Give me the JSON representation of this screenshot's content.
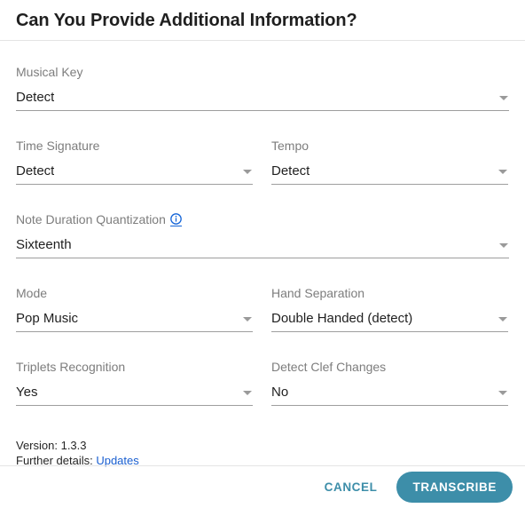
{
  "dialog": {
    "title": "Can You Provide Additional Information?"
  },
  "fields": {
    "musical_key": {
      "label": "Musical Key",
      "value": "Detect"
    },
    "time_signature": {
      "label": "Time Signature",
      "value": "Detect"
    },
    "tempo": {
      "label": "Tempo",
      "value": "Detect"
    },
    "quantization": {
      "label": "Note Duration Quantization",
      "value": "Sixteenth",
      "info_icon": "info-icon"
    },
    "mode": {
      "label": "Mode",
      "value": "Pop Music"
    },
    "hand_separation": {
      "label": "Hand Separation",
      "value": "Double Handed (detect)"
    },
    "triplets": {
      "label": "Triplets Recognition",
      "value": "Yes"
    },
    "clef_changes": {
      "label": "Detect Clef Changes",
      "value": "No"
    }
  },
  "version": {
    "version_line": "Version: 1.3.3",
    "details_prefix": "Further details:",
    "updates_link": "Updates"
  },
  "footer": {
    "cancel_label": "CANCEL",
    "transcribe_label": "TRANSCRIBE"
  },
  "colors": {
    "accent": "#3d8ea9",
    "link": "#1a5fd0",
    "info": "#1565d8",
    "label": "#7d7d7d",
    "divider": "#e4e4e4",
    "underline": "#9e9e9e"
  },
  "icons": {
    "caret": "chevron-down-icon"
  }
}
